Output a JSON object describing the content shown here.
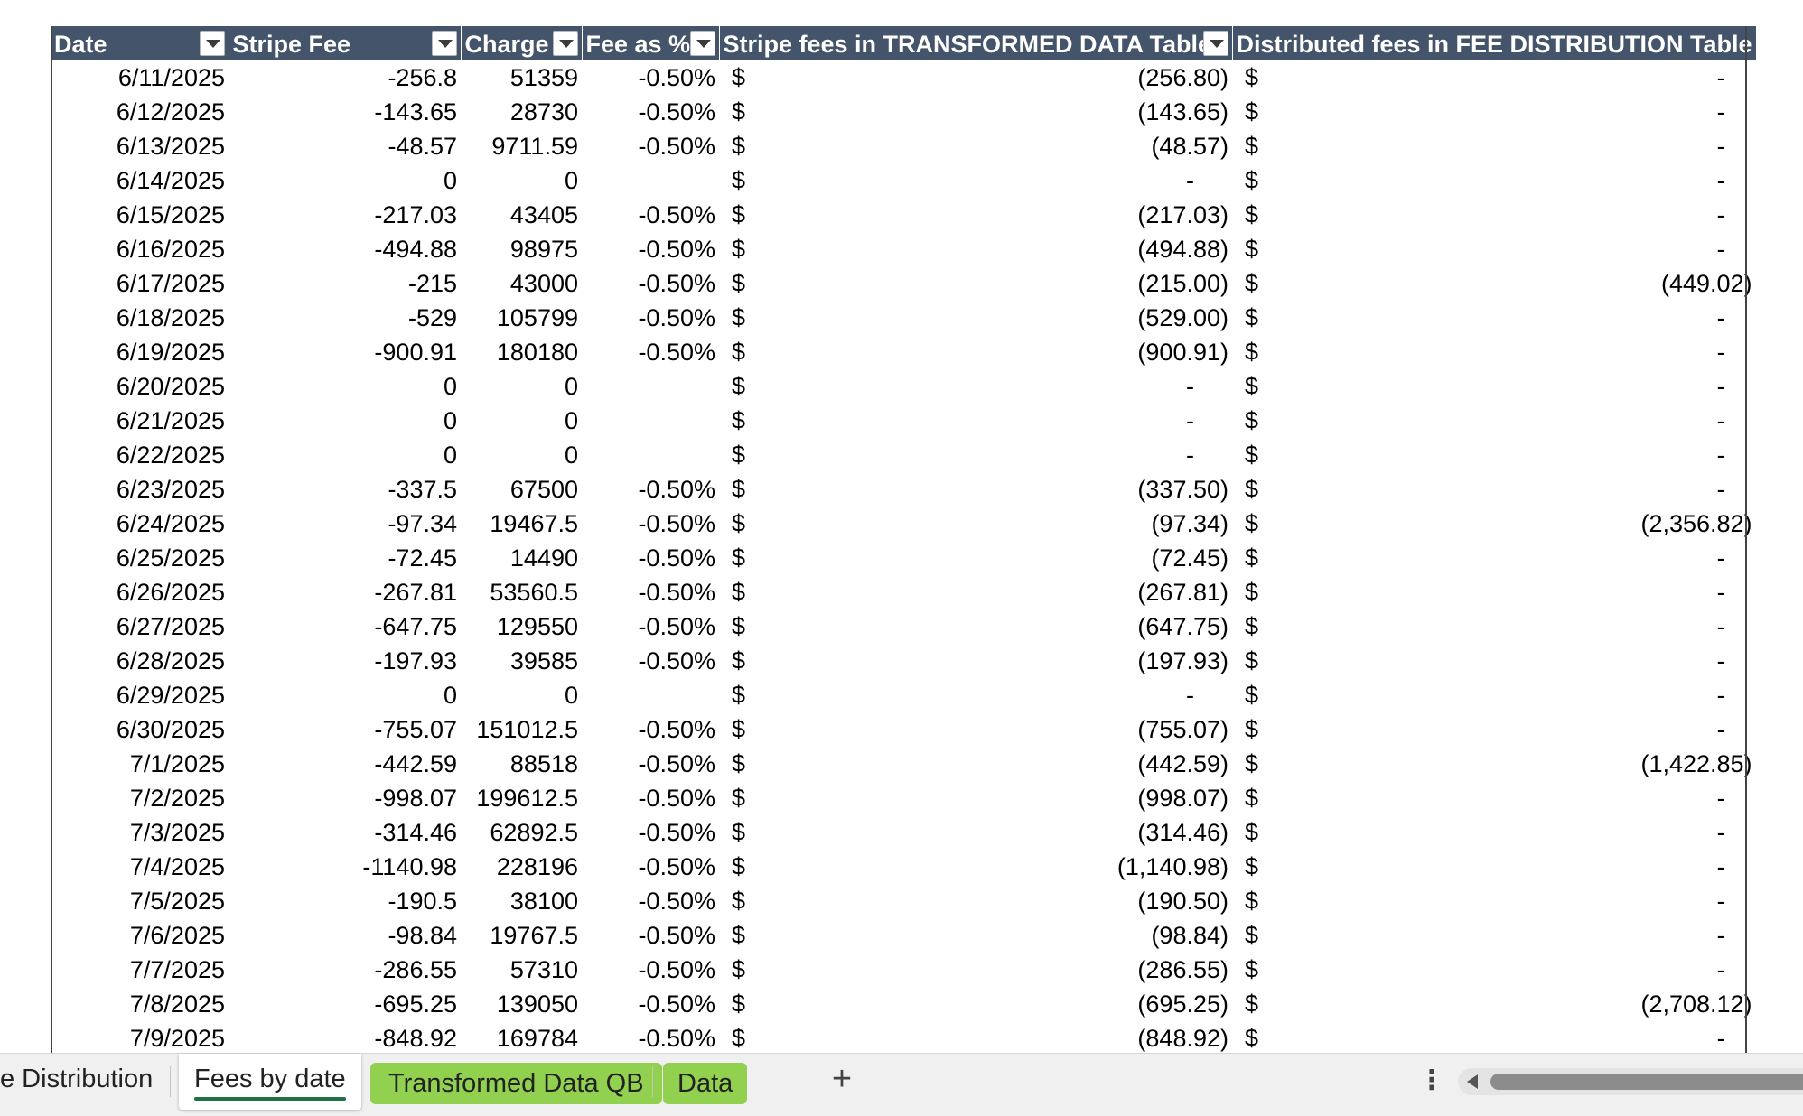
{
  "table": {
    "headers": {
      "date": "Date",
      "stripe_fee": "Stripe Fee",
      "charge": "Charge",
      "fee_pct": "Fee as %",
      "stripe_fees_transformed": "Stripe fees in TRANSFORMED DATA Table",
      "distributed_fees": "Distributed fees in FEE DISTRIBUTION Table"
    },
    "currency_symbol": "$",
    "rows": [
      {
        "date": "6/11/2025",
        "stripe_fee": "-256.8",
        "charge": "51359",
        "fee_pct": "-0.50%",
        "transformed": "(256.80)",
        "distributed": "-"
      },
      {
        "date": "6/12/2025",
        "stripe_fee": "-143.65",
        "charge": "28730",
        "fee_pct": "-0.50%",
        "transformed": "(143.65)",
        "distributed": "-"
      },
      {
        "date": "6/13/2025",
        "stripe_fee": "-48.57",
        "charge": "9711.59",
        "fee_pct": "-0.50%",
        "transformed": "(48.57)",
        "distributed": "-"
      },
      {
        "date": "6/14/2025",
        "stripe_fee": "0",
        "charge": "0",
        "fee_pct": "",
        "transformed": "-",
        "distributed": "-"
      },
      {
        "date": "6/15/2025",
        "stripe_fee": "-217.03",
        "charge": "43405",
        "fee_pct": "-0.50%",
        "transformed": "(217.03)",
        "distributed": "-"
      },
      {
        "date": "6/16/2025",
        "stripe_fee": "-494.88",
        "charge": "98975",
        "fee_pct": "-0.50%",
        "transformed": "(494.88)",
        "distributed": "-"
      },
      {
        "date": "6/17/2025",
        "stripe_fee": "-215",
        "charge": "43000",
        "fee_pct": "-0.50%",
        "transformed": "(215.00)",
        "distributed": "(449.02)"
      },
      {
        "date": "6/18/2025",
        "stripe_fee": "-529",
        "charge": "105799",
        "fee_pct": "-0.50%",
        "transformed": "(529.00)",
        "distributed": "-"
      },
      {
        "date": "6/19/2025",
        "stripe_fee": "-900.91",
        "charge": "180180",
        "fee_pct": "-0.50%",
        "transformed": "(900.91)",
        "distributed": "-"
      },
      {
        "date": "6/20/2025",
        "stripe_fee": "0",
        "charge": "0",
        "fee_pct": "",
        "transformed": "-",
        "distributed": "-"
      },
      {
        "date": "6/21/2025",
        "stripe_fee": "0",
        "charge": "0",
        "fee_pct": "",
        "transformed": "-",
        "distributed": "-"
      },
      {
        "date": "6/22/2025",
        "stripe_fee": "0",
        "charge": "0",
        "fee_pct": "",
        "transformed": "-",
        "distributed": "-"
      },
      {
        "date": "6/23/2025",
        "stripe_fee": "-337.5",
        "charge": "67500",
        "fee_pct": "-0.50%",
        "transformed": "(337.50)",
        "distributed": "-"
      },
      {
        "date": "6/24/2025",
        "stripe_fee": "-97.34",
        "charge": "19467.5",
        "fee_pct": "-0.50%",
        "transformed": "(97.34)",
        "distributed": "(2,356.82)"
      },
      {
        "date": "6/25/2025",
        "stripe_fee": "-72.45",
        "charge": "14490",
        "fee_pct": "-0.50%",
        "transformed": "(72.45)",
        "distributed": "-"
      },
      {
        "date": "6/26/2025",
        "stripe_fee": "-267.81",
        "charge": "53560.5",
        "fee_pct": "-0.50%",
        "transformed": "(267.81)",
        "distributed": "-"
      },
      {
        "date": "6/27/2025",
        "stripe_fee": "-647.75",
        "charge": "129550",
        "fee_pct": "-0.50%",
        "transformed": "(647.75)",
        "distributed": "-"
      },
      {
        "date": "6/28/2025",
        "stripe_fee": "-197.93",
        "charge": "39585",
        "fee_pct": "-0.50%",
        "transformed": "(197.93)",
        "distributed": "-"
      },
      {
        "date": "6/29/2025",
        "stripe_fee": "0",
        "charge": "0",
        "fee_pct": "",
        "transformed": "-",
        "distributed": "-"
      },
      {
        "date": "6/30/2025",
        "stripe_fee": "-755.07",
        "charge": "151012.5",
        "fee_pct": "-0.50%",
        "transformed": "(755.07)",
        "distributed": "-"
      },
      {
        "date": "7/1/2025",
        "stripe_fee": "-442.59",
        "charge": "88518",
        "fee_pct": "-0.50%",
        "transformed": "(442.59)",
        "distributed": "(1,422.85)"
      },
      {
        "date": "7/2/2025",
        "stripe_fee": "-998.07",
        "charge": "199612.5",
        "fee_pct": "-0.50%",
        "transformed": "(998.07)",
        "distributed": "-"
      },
      {
        "date": "7/3/2025",
        "stripe_fee": "-314.46",
        "charge": "62892.5",
        "fee_pct": "-0.50%",
        "transformed": "(314.46)",
        "distributed": "-"
      },
      {
        "date": "7/4/2025",
        "stripe_fee": "-1140.98",
        "charge": "228196",
        "fee_pct": "-0.50%",
        "transformed": "(1,140.98)",
        "distributed": "-"
      },
      {
        "date": "7/5/2025",
        "stripe_fee": "-190.5",
        "charge": "38100",
        "fee_pct": "-0.50%",
        "transformed": "(190.50)",
        "distributed": "-"
      },
      {
        "date": "7/6/2025",
        "stripe_fee": "-98.84",
        "charge": "19767.5",
        "fee_pct": "-0.50%",
        "transformed": "(98.84)",
        "distributed": "-"
      },
      {
        "date": "7/7/2025",
        "stripe_fee": "-286.55",
        "charge": "57310",
        "fee_pct": "-0.50%",
        "transformed": "(286.55)",
        "distributed": "-"
      },
      {
        "date": "7/8/2025",
        "stripe_fee": "-695.25",
        "charge": "139050",
        "fee_pct": "-0.50%",
        "transformed": "(695.25)",
        "distributed": "(2,708.12)"
      },
      {
        "date": "7/9/2025",
        "stripe_fee": "-848.92",
        "charge": "169784",
        "fee_pct": "-0.50%",
        "transformed": "(848.92)",
        "distributed": "-"
      }
    ]
  },
  "tabs": {
    "fee_distribution": "e Distribution",
    "fees_by_date": "Fees by date",
    "transformed_qb": "Transformed Data QB",
    "data": "Data",
    "add": "+",
    "more": "⋮"
  },
  "colors": {
    "header_bg": "#44546a",
    "header_text": "#ffffff",
    "tab_green": "#92d050",
    "active_tab_underline": "#1e7145"
  },
  "icons": {
    "filter": "filter-dropdown-icon",
    "add_sheet": "plus-icon",
    "more": "vertical-ellipsis-icon",
    "scroll_left": "triangle-left-icon"
  }
}
